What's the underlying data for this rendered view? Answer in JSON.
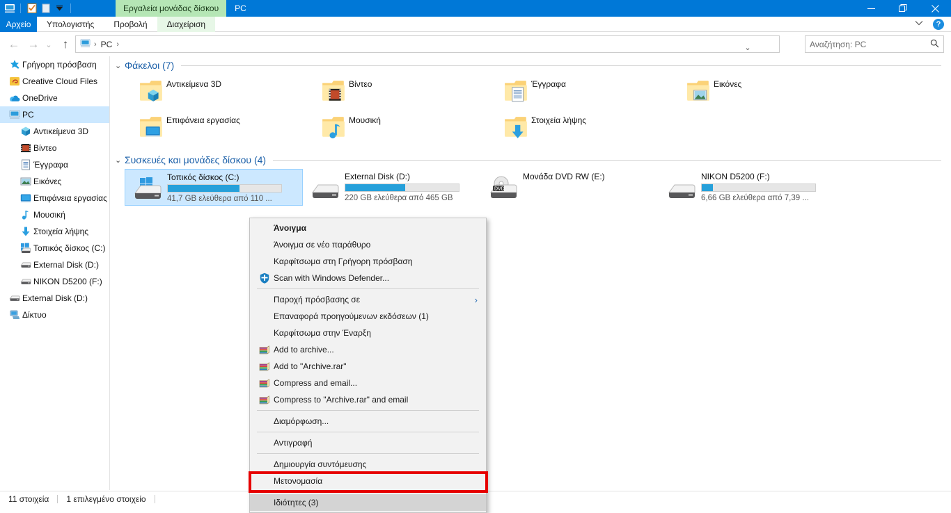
{
  "window": {
    "quick_access_icons": [
      "pc-icon",
      "properties-icon",
      "new-folder-icon",
      "customize-chevron-icon"
    ],
    "context_tab_group": "Εργαλεία μονάδας δίσκου",
    "title": "PC",
    "controls": {
      "minimize": "—",
      "maximize": "❐",
      "close": "✕"
    }
  },
  "ribbon": {
    "file_tab": "Αρχείο",
    "tabs": [
      {
        "label": "Υπολογιστής",
        "context": false
      },
      {
        "label": "Προβολή",
        "context": false
      },
      {
        "label": "Διαχείριση",
        "context": true
      }
    ],
    "collapse_icon": "chevron-down-icon",
    "help_label": "?"
  },
  "address": {
    "back_icon": "←",
    "forward_icon": "→",
    "recent_icon": "⌄",
    "up_icon": "↑",
    "location_icon": "pc-icon",
    "crumbs": [
      "PC"
    ],
    "separator": "›",
    "dropdown_icon": "⌄",
    "refresh_icon": "↻"
  },
  "search": {
    "placeholder": "Αναζήτηση: PC",
    "value": "",
    "icon": "search-icon"
  },
  "sidebar": {
    "items": [
      {
        "label": "Γρήγορη πρόσβαση",
        "icon": "star-pin-icon",
        "level": 0,
        "selected": false
      },
      {
        "label": "Creative Cloud Files",
        "icon": "creative-cloud-icon",
        "level": 0,
        "selected": false
      },
      {
        "label": "OneDrive",
        "icon": "onedrive-cloud-icon",
        "level": 0,
        "selected": false
      },
      {
        "label": "PC",
        "icon": "pc-icon",
        "level": 0,
        "selected": true
      },
      {
        "label": "Αντικείμενα 3D",
        "icon": "3d-objects-icon",
        "level": 1,
        "selected": false
      },
      {
        "label": "Βίντεο",
        "icon": "video-icon",
        "level": 1,
        "selected": false
      },
      {
        "label": "Έγγραφα",
        "icon": "documents-icon",
        "level": 1,
        "selected": false
      },
      {
        "label": "Εικόνες",
        "icon": "pictures-icon",
        "level": 1,
        "selected": false
      },
      {
        "label": "Επιφάνεια εργασίας",
        "icon": "desktop-icon",
        "level": 1,
        "selected": false
      },
      {
        "label": "Μουσική",
        "icon": "music-icon",
        "level": 1,
        "selected": false
      },
      {
        "label": "Στοιχεία λήψης",
        "icon": "downloads-icon",
        "level": 1,
        "selected": false
      },
      {
        "label": "Τοπικός δίσκος (C:)",
        "icon": "windows-drive-icon",
        "level": 1,
        "selected": false
      },
      {
        "label": "External Disk (D:)",
        "icon": "drive-icon",
        "level": 1,
        "selected": false
      },
      {
        "label": "NIKON D5200 (F:)",
        "icon": "drive-icon",
        "level": 1,
        "selected": false
      },
      {
        "label": "External Disk (D:)",
        "icon": "drive-icon",
        "level": 0,
        "selected": false
      },
      {
        "label": "Δίκτυο",
        "icon": "network-icon",
        "level": 0,
        "selected": false
      }
    ]
  },
  "main": {
    "folders_group": {
      "chevron": "⌄",
      "title": "Φάκελοι (7)"
    },
    "folders": [
      {
        "label": "Αντικείμενα 3D",
        "icon": "folder-3d-objects-icon"
      },
      {
        "label": "Βίντεο",
        "icon": "folder-videos-icon"
      },
      {
        "label": "Έγγραφα",
        "icon": "folder-documents-icon"
      },
      {
        "label": "Εικόνες",
        "icon": "folder-pictures-icon"
      },
      {
        "label": "Επιφάνεια εργασίας",
        "icon": "folder-desktop-icon"
      },
      {
        "label": "Μουσική",
        "icon": "folder-music-icon"
      },
      {
        "label": "Στοιχεία λήψης",
        "icon": "folder-downloads-icon"
      }
    ],
    "drives_group": {
      "chevron": "⌄",
      "title": "Συσκευές και μονάδες δίσκου (4)"
    },
    "drives": [
      {
        "name": "Τοπικός δίσκος (C:)",
        "free_text": "41,7 GB ελεύθερα από 110 ...",
        "used_percent": 63,
        "icon": "windows-hdd-icon",
        "has_bar": true,
        "selected": true
      },
      {
        "name": "External Disk (D:)",
        "free_text": "220 GB ελεύθερα από 465 GB",
        "used_percent": 53,
        "icon": "hdd-icon",
        "has_bar": true,
        "selected": false
      },
      {
        "name": "Μονάδα DVD RW (E:)",
        "free_text": "",
        "used_percent": 0,
        "icon": "dvd-drive-icon",
        "has_bar": false,
        "selected": false
      },
      {
        "name": "NIKON D5200 (F:)",
        "free_text": "6,66 GB ελεύθερα από 7,39 ...",
        "used_percent": 10,
        "icon": "hdd-icon",
        "has_bar": true,
        "selected": false
      }
    ]
  },
  "context_menu": {
    "items": [
      {
        "label": "Άνοιγμα",
        "icon": "",
        "bold": true,
        "separator_after": false,
        "submenu": false,
        "highlighted": false
      },
      {
        "label": "Άνοιγμα σε νέο παράθυρο",
        "icon": "",
        "bold": false,
        "separator_after": false,
        "submenu": false,
        "highlighted": false
      },
      {
        "label": "Καρφίτσωμα στη Γρήγορη πρόσβαση",
        "icon": "",
        "bold": false,
        "separator_after": false,
        "submenu": false,
        "highlighted": false
      },
      {
        "label": "Scan with Windows Defender...",
        "icon": "defender-shield-icon",
        "bold": false,
        "separator_after": true,
        "submenu": false,
        "highlighted": false
      },
      {
        "label": "Παροχή πρόσβασης σε",
        "icon": "",
        "bold": false,
        "separator_after": false,
        "submenu": true,
        "highlighted": false
      },
      {
        "label": "Επαναφορά προηγούμενων εκδόσεων (1)",
        "icon": "",
        "bold": false,
        "separator_after": false,
        "submenu": false,
        "highlighted": false
      },
      {
        "label": "Καρφίτσωμα στην Έναρξη",
        "icon": "",
        "bold": false,
        "separator_after": false,
        "submenu": false,
        "highlighted": false
      },
      {
        "label": "Add to archive...",
        "icon": "winrar-icon",
        "bold": false,
        "separator_after": false,
        "submenu": false,
        "highlighted": false
      },
      {
        "label": "Add to \"Archive.rar\"",
        "icon": "winrar-icon",
        "bold": false,
        "separator_after": false,
        "submenu": false,
        "highlighted": false
      },
      {
        "label": "Compress and email...",
        "icon": "winrar-icon",
        "bold": false,
        "separator_after": false,
        "submenu": false,
        "highlighted": false
      },
      {
        "label": "Compress to \"Archive.rar\" and email",
        "icon": "winrar-icon",
        "bold": false,
        "separator_after": true,
        "submenu": false,
        "highlighted": false
      },
      {
        "label": "Διαμόρφωση...",
        "icon": "",
        "bold": false,
        "separator_after": true,
        "submenu": false,
        "highlighted": false
      },
      {
        "label": "Αντιγραφή",
        "icon": "",
        "bold": false,
        "separator_after": true,
        "submenu": false,
        "highlighted": false
      },
      {
        "label": "Δημιουργία συντόμευσης",
        "icon": "",
        "bold": false,
        "separator_after": false,
        "submenu": false,
        "highlighted": false
      },
      {
        "label": "Μετονομασία",
        "icon": "",
        "bold": false,
        "separator_after": true,
        "submenu": false,
        "highlighted": false
      },
      {
        "label": "Ιδιότητες (3)",
        "icon": "",
        "bold": false,
        "separator_after": false,
        "submenu": false,
        "highlighted": true
      }
    ],
    "highlight_color": "#e60000"
  },
  "status": {
    "item_count": "11 στοιχεία",
    "selection": "1 επιλεγμένο στοιχείο"
  }
}
